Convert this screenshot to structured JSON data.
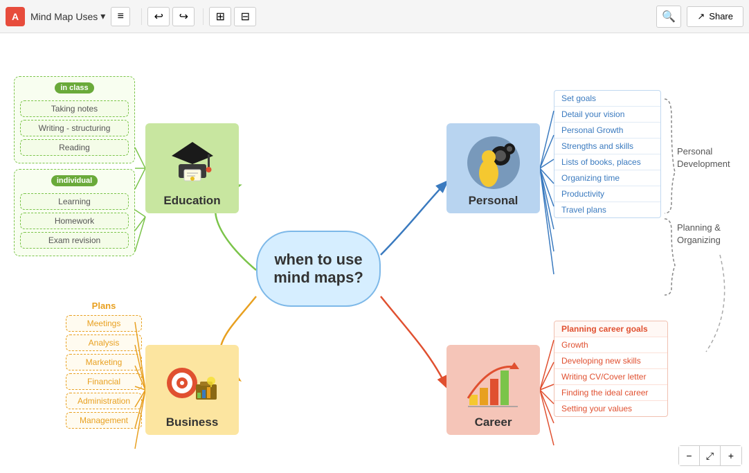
{
  "app": {
    "logo": "A",
    "title": "Mind Map Uses",
    "share_label": "Share"
  },
  "toolbar": {
    "undo_label": "←",
    "redo_label": "→",
    "layout1_label": "⊞",
    "layout2_label": "⊟",
    "search_icon": "🔍",
    "share_icon": "↗"
  },
  "center": {
    "text": "when to use mind maps?"
  },
  "education": {
    "label": "Education",
    "tag_in_class": "in class",
    "tag_individual": "individual",
    "items_class": [
      "Taking notes",
      "Writing - structuring",
      "Reading"
    ],
    "items_individual": [
      "Learning",
      "Homework",
      "Exam revision"
    ]
  },
  "personal": {
    "label": "Personal",
    "items": [
      "Set goals",
      "Detail your vision",
      "Personal Growth",
      "Strengths and skills",
      "Lists of books, places",
      "Organizing time",
      "Productivity",
      "Travel plans"
    ]
  },
  "career": {
    "label": "Career",
    "items": [
      "Planning career goals",
      "Growth",
      "Developing new skills",
      "Writing CV/Cover letter",
      "Finding the ideal career",
      "Setting  your values"
    ]
  },
  "business": {
    "label": "Business",
    "tag_label": "Plans",
    "items": [
      "Meetings",
      "Analysis",
      "Marketing",
      "Financial",
      "Administration",
      "Management"
    ]
  },
  "labels": {
    "personal_development": "Personal\nDevelopment",
    "planning_organizing": "Planning &\nOrganizing"
  },
  "zoom": {
    "minus": "−",
    "fit": "⤢",
    "plus": "+"
  }
}
